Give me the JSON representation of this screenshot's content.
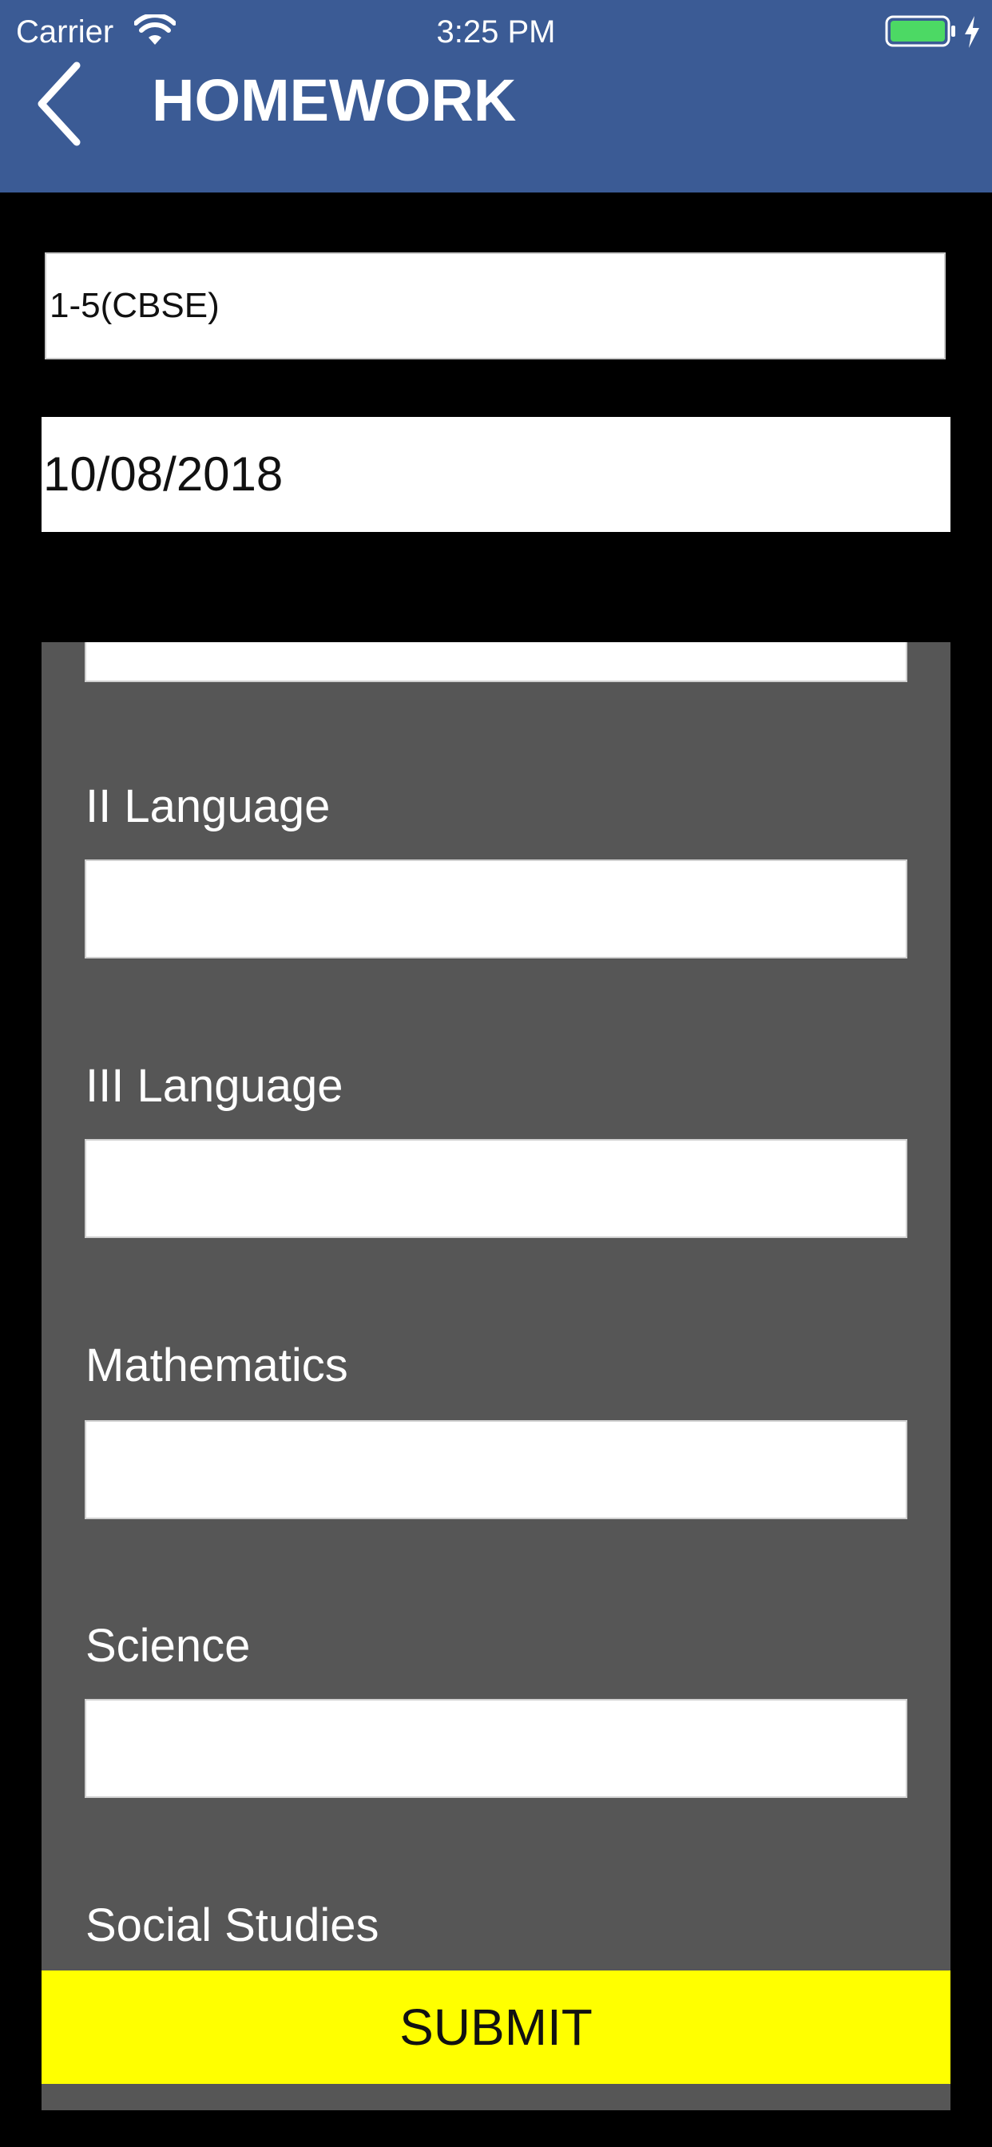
{
  "status_bar": {
    "carrier": "Carrier",
    "time": "3:25 PM",
    "battery_color": "#4cd964"
  },
  "nav": {
    "title": "HOMEWORK",
    "back_icon": "chevron-left-icon",
    "background_color": "#3b5b95"
  },
  "form": {
    "class_value": "1-5(CBSE)",
    "date_value": "10/08/2018",
    "subjects": [
      {
        "label": "",
        "value": ""
      },
      {
        "label": "II Language",
        "value": ""
      },
      {
        "label": "III Language",
        "value": ""
      },
      {
        "label": "Mathematics",
        "value": ""
      },
      {
        "label": "Science",
        "value": ""
      },
      {
        "label": "Social Studies",
        "value": ""
      }
    ],
    "submit_label": "SUBMIT",
    "submit_color": "#ffff00",
    "panel_color": "#565656"
  }
}
